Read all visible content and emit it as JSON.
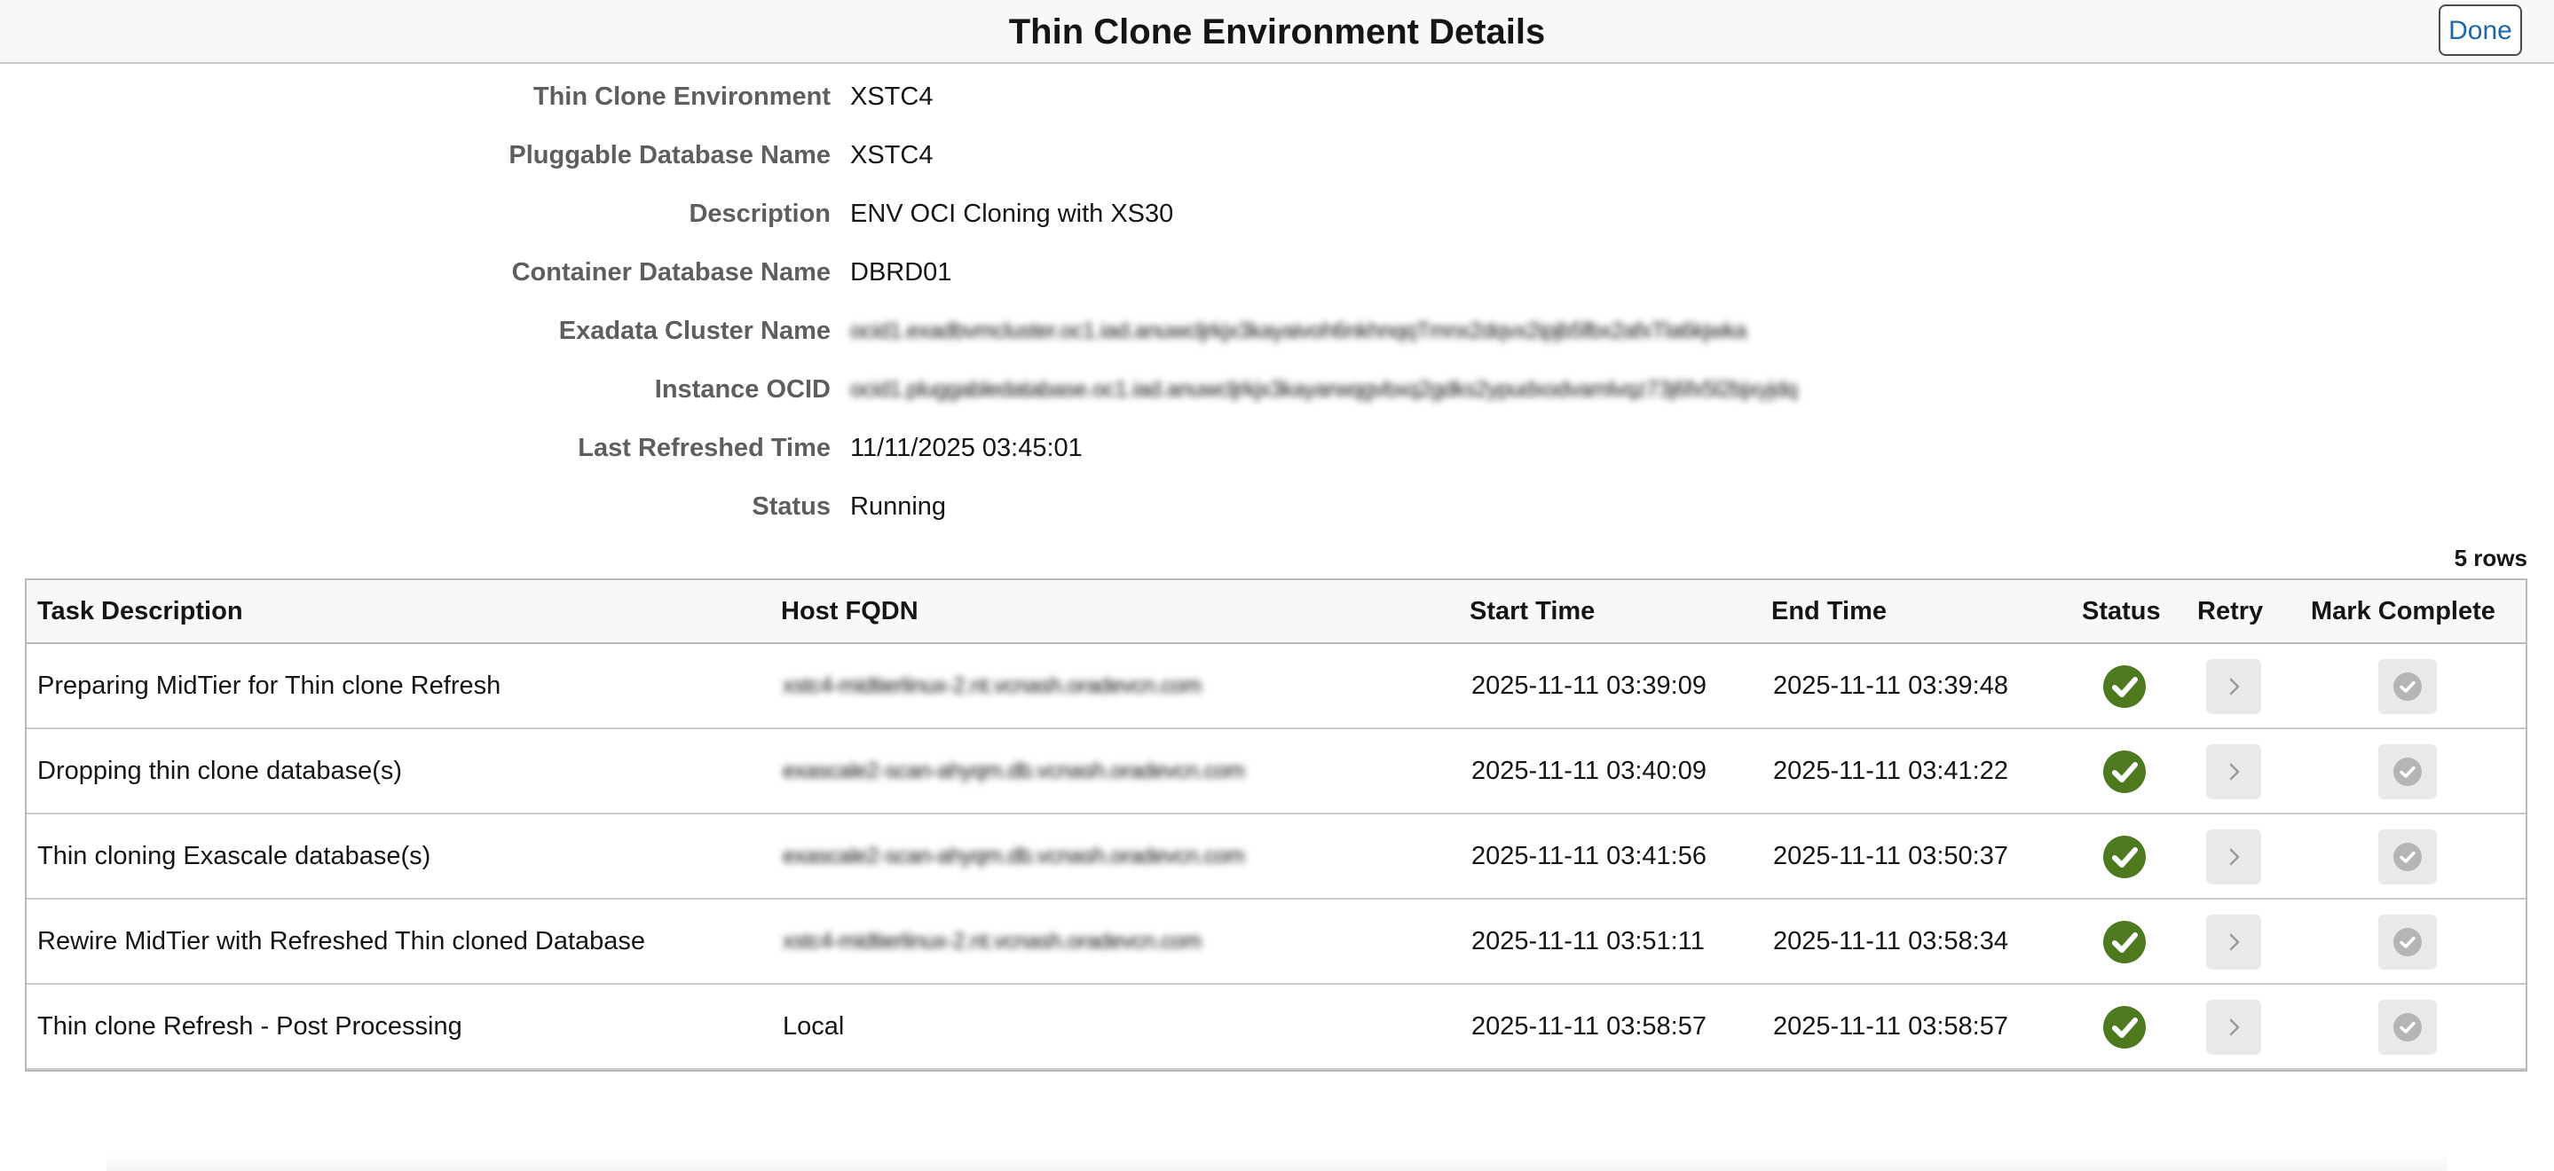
{
  "header": {
    "title": "Thin Clone Environment Details",
    "done_label": "Done"
  },
  "fields": [
    {
      "label": "Thin Clone Environment",
      "value": "XSTC4"
    },
    {
      "label": "Pluggable Database Name",
      "value": "XSTC4"
    },
    {
      "label": "Description",
      "value": "ENV OCI Cloning with XS30"
    },
    {
      "label": "Container Database Name",
      "value": "DBRD01"
    },
    {
      "label": "Exadata Cluster Name",
      "value": "ocid1.exadbvmcluster.oc1.iad.anuwcljrkjx3kayaivoh6nkhnqqTmnx2dqvx2ipjb5fbx2afxTla6kjwka"
    },
    {
      "label": "Instance OCID",
      "value": "ocid1.pluggabledatabase.oc1.iad.anuwcljrkjx3kayarwqgvbxq2gdks2ypudxodvamlvqz73j6fx5l2bjxyjdq"
    },
    {
      "label": "Last Refreshed Time",
      "value": "11/11/2025 03:45:01"
    },
    {
      "label": "Status",
      "value": "Running"
    }
  ],
  "table": {
    "row_count": "5 rows",
    "columns": [
      "Task Description",
      "Host FQDN",
      "Start Time",
      "End Time",
      "Status",
      "Retry",
      "Mark Complete"
    ],
    "rows": [
      {
        "task": "Preparing MidTier for Thin clone Refresh",
        "host": "xstc4-midtierlinux-2.nt.vcnash.oradevcn.com",
        "start": "2025-11-11 03:39:09",
        "end": "2025-11-11 03:39:48",
        "status": "complete",
        "host_redacted": true
      },
      {
        "task": "Dropping thin clone database(s)",
        "host": "exascale2-scan-ahyqm.db.vcnash.oradevcn.com",
        "start": "2025-11-11 03:40:09",
        "end": "2025-11-11 03:41:22",
        "status": "complete",
        "host_redacted": true
      },
      {
        "task": "Thin cloning Exascale database(s)",
        "host": "exascale2-scan-ahyqm.db.vcnash.oradevcn.com",
        "start": "2025-11-11 03:41:56",
        "end": "2025-11-11 03:50:37",
        "status": "complete",
        "host_redacted": true
      },
      {
        "task": "Rewire MidTier with Refreshed Thin cloned Database",
        "host": "xstc4-midtierlinux-2.nt.vcnash.oradevcn.com",
        "start": "2025-11-11 03:51:11",
        "end": "2025-11-11 03:58:34",
        "status": "complete",
        "host_redacted": true
      },
      {
        "task": "Thin clone Refresh - Post Processing",
        "host": "Local",
        "start": "2025-11-11 03:58:57",
        "end": "2025-11-11 03:58:57",
        "status": "complete",
        "host_redacted": false
      }
    ]
  },
  "icons": {
    "status": "check-circle-icon",
    "retry": "chevron-right-icon",
    "mark_complete": "check-circle-icon"
  },
  "colors": {
    "status_complete": "#4e7a1f",
    "accent_link": "#1e66a8",
    "disabled_button": "#e9e9e9"
  }
}
